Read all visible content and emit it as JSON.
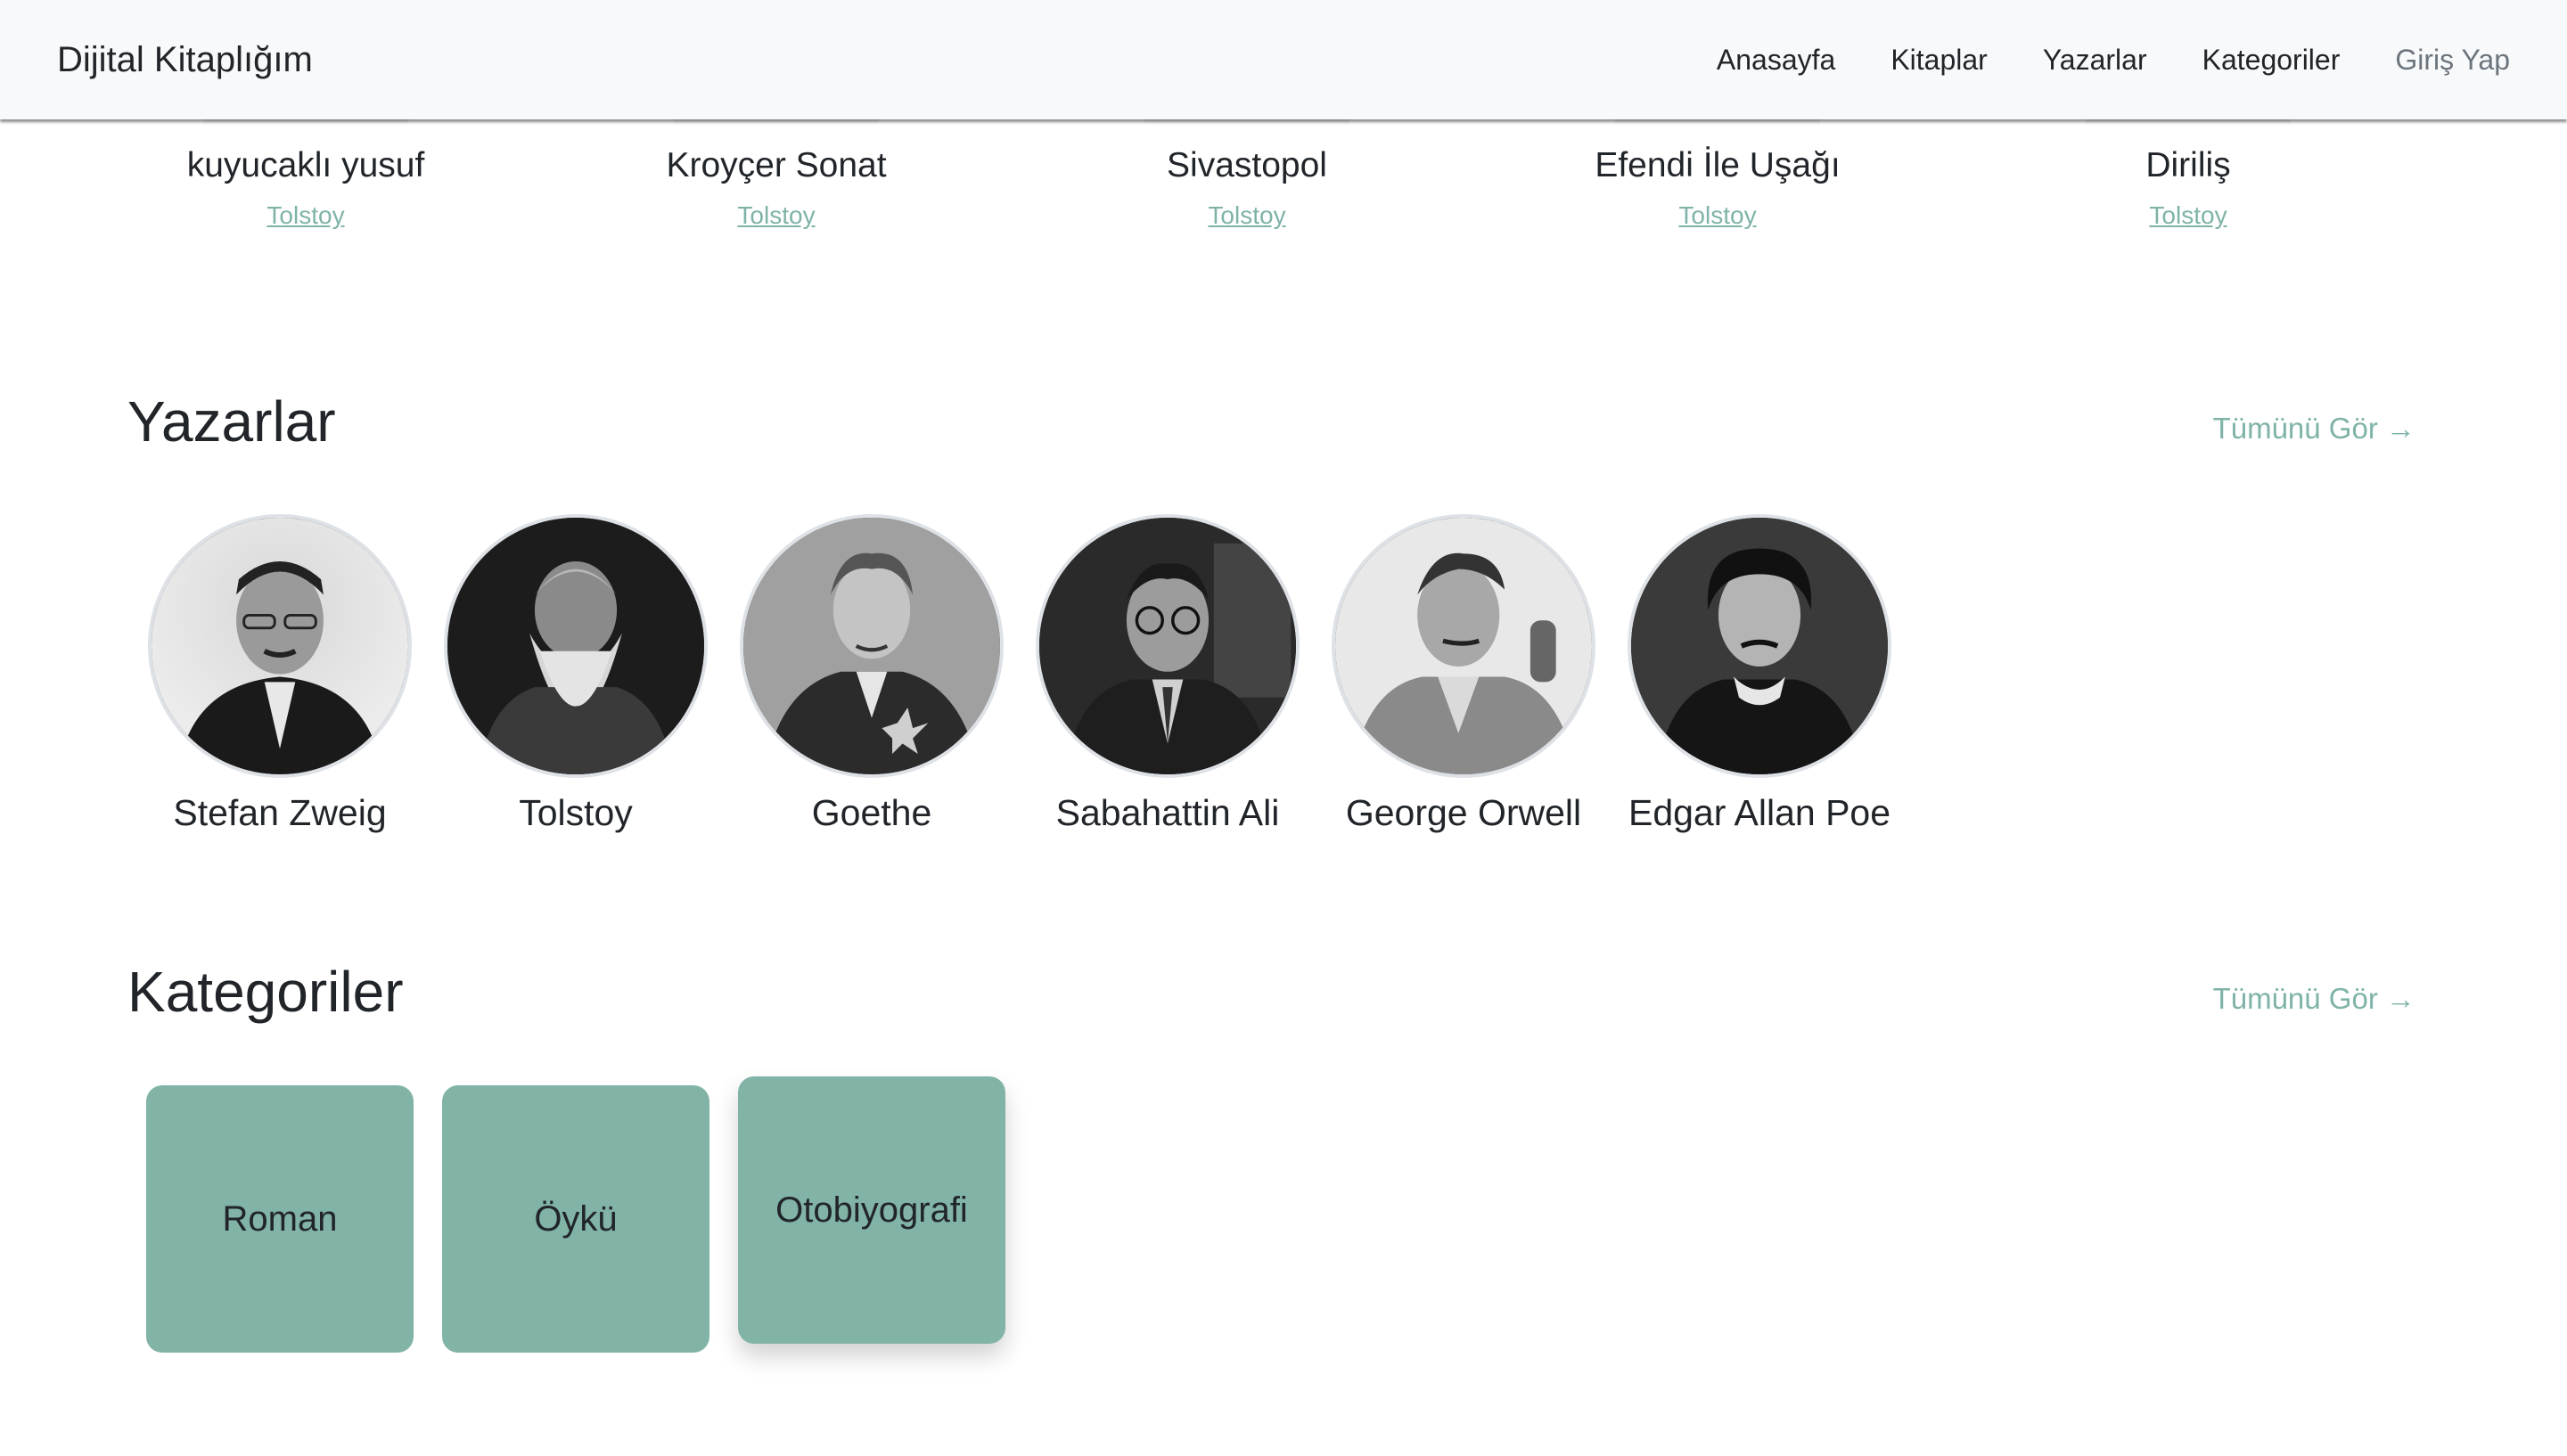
{
  "navbar": {
    "brand": "Dijital Kitaplığım",
    "links": [
      {
        "label": "Anasayfa"
      },
      {
        "label": "Kitaplar"
      },
      {
        "label": "Yazarlar"
      },
      {
        "label": "Kategoriler"
      },
      {
        "label": "Giriş Yap"
      }
    ]
  },
  "books": [
    {
      "title": "kuyucaklı yusuf",
      "author": "Tolstoy"
    },
    {
      "title": "Kroyçer Sonat",
      "author": "Tolstoy"
    },
    {
      "title": "Sivastopol",
      "author": "Tolstoy"
    },
    {
      "title": "Efendi İle Uşağı",
      "author": "Tolstoy"
    },
    {
      "title": "Diriliş",
      "author": "Tolstoy"
    }
  ],
  "authors_section": {
    "title": "Yazarlar",
    "see_all": "Tümünü Gör →",
    "items": [
      {
        "name": "Stefan Zweig",
        "image": "author-portrait"
      },
      {
        "name": "Tolstoy",
        "image": "author-portrait"
      },
      {
        "name": "Goethe",
        "image": "author-portrait"
      },
      {
        "name": "Sabahattin Ali",
        "image": "author-portrait"
      },
      {
        "name": "George Orwell",
        "image": "author-portrait"
      },
      {
        "name": "Edgar Allan Poe",
        "image": "author-portrait"
      }
    ]
  },
  "categories_section": {
    "title": "Kategoriler",
    "see_all": "Tümünü Gör →",
    "items": [
      {
        "label": "Roman"
      },
      {
        "label": "Öykü"
      },
      {
        "label": "Otobiyografi"
      }
    ]
  },
  "colors": {
    "accent": "#7fb3a8",
    "category_card": "#81b3a7",
    "navbar_bg": "#f8f9fa",
    "text": "#212529",
    "muted": "#6c757d"
  }
}
